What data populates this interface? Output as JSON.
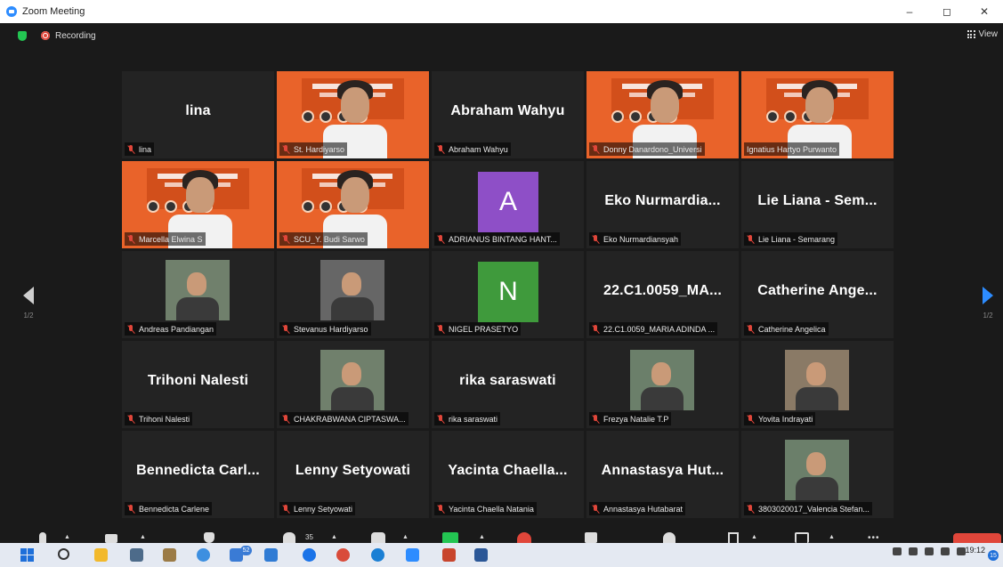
{
  "window": {
    "title": "Zoom Meeting",
    "min_symbol": "–",
    "max_symbol": "◻",
    "close_symbol": "✕"
  },
  "status": {
    "recording_label": "Recording",
    "view_label": "View"
  },
  "pager": {
    "left_label": "1/2",
    "right_label": "1/2"
  },
  "participants": [
    {
      "display": "lina",
      "name": "lina",
      "type": "name",
      "muted": true
    },
    {
      "display": "",
      "name": "St. Hardiyarso",
      "type": "video",
      "muted": true
    },
    {
      "display": "Abraham Wahyu",
      "name": "Abraham Wahyu",
      "type": "name",
      "muted": true
    },
    {
      "display": "",
      "name": "Donny Danardono_Universi",
      "type": "video",
      "muted": true
    },
    {
      "display": "",
      "name": "Ignatius Hartyo Purwanto",
      "type": "video",
      "muted": false,
      "active": true
    },
    {
      "display": "",
      "name": "Marcella Elwina S",
      "type": "video",
      "muted": true
    },
    {
      "display": "",
      "name": "SCU_Y. Budi Sarwo",
      "type": "video",
      "muted": true
    },
    {
      "display": "A",
      "name": "ADRIANUS BINTANG HANT...",
      "type": "avatar",
      "avatar_color": "#8e4fc7",
      "muted": true
    },
    {
      "display": "Eko  Nurmardia...",
      "name": "Eko Nurmardiansyah",
      "type": "name",
      "muted": true
    },
    {
      "display": "Lie  Liana  -  Sem...",
      "name": "Lie Liana - Semarang",
      "type": "name",
      "muted": true
    },
    {
      "display": "",
      "name": "Andreas Pandiangan",
      "type": "photo",
      "muted": true
    },
    {
      "display": "",
      "name": "Stevanus Hardiyarso",
      "type": "photo",
      "muted": true
    },
    {
      "display": "N",
      "name": "NIGEL PRASETYO",
      "type": "avatar",
      "avatar_color": "#3f9a3c",
      "muted": true
    },
    {
      "display": "22.C1.0059_MA...",
      "name": "22.C1.0059_MARIA ADINDA ...",
      "type": "name",
      "muted": true
    },
    {
      "display": "Catherine  Ange...",
      "name": "Catherine Angelica",
      "type": "name",
      "muted": true
    },
    {
      "display": "Trihoni Nalesti",
      "name": "Trihoni Nalesti",
      "type": "name",
      "muted": true
    },
    {
      "display": "",
      "name": "CHAKRABWANA CIPTASWA...",
      "type": "photo",
      "muted": true
    },
    {
      "display": "rika saraswati",
      "name": "rika saraswati",
      "type": "name",
      "muted": true
    },
    {
      "display": "",
      "name": "Frezya Natalie T.P",
      "type": "photo",
      "muted": true
    },
    {
      "display": "",
      "name": "Yovita Indrayati",
      "type": "photo",
      "muted": true
    },
    {
      "display": "Bennedicta  Carl...",
      "name": "Bennedicta Carlene",
      "type": "name",
      "muted": true
    },
    {
      "display": "Lenny Setyowati",
      "name": "Lenny Setyowati",
      "type": "name",
      "muted": true
    },
    {
      "display": "Yacinta  Chaella...",
      "name": "Yacinta Chaella Natania",
      "type": "name",
      "muted": true
    },
    {
      "display": "Annastasya  Hut...",
      "name": "Annastasya Hutabarat",
      "type": "name",
      "muted": true
    },
    {
      "display": "",
      "name": "3803020017_Valencia Stefan...",
      "type": "photo",
      "muted": true
    }
  ],
  "toolbar": {
    "participants_count": "35",
    "more_label": "•••"
  },
  "taskbar": {
    "badge_count": "52",
    "time": "19:12",
    "notifications": "15"
  }
}
